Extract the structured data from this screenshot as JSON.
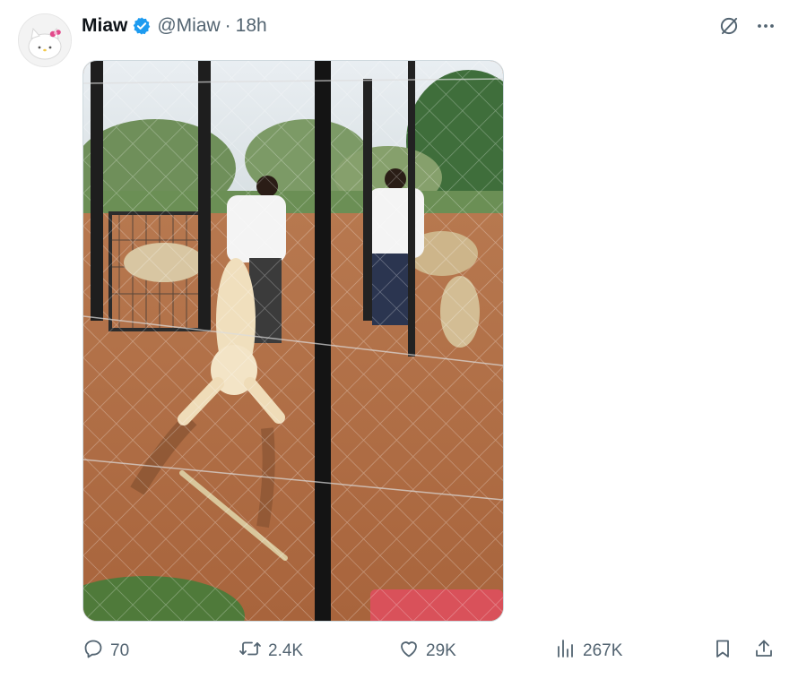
{
  "post": {
    "author_name": "Miaw",
    "handle": "@Miaw",
    "separator": "·",
    "time": "18h"
  },
  "media": {
    "description_icon": "photo-lion-cage"
  },
  "actions": {
    "replies": "70",
    "reposts": "2.4K",
    "likes": "29K",
    "views": "267K"
  },
  "colors": {
    "verified": "#1d9bf0",
    "muted": "#536471",
    "text": "#0f1419"
  },
  "icons": [
    "grok-icon",
    "more-icon",
    "reply-icon",
    "repost-icon",
    "like-icon",
    "views-icon",
    "bookmark-icon",
    "share-icon"
  ]
}
